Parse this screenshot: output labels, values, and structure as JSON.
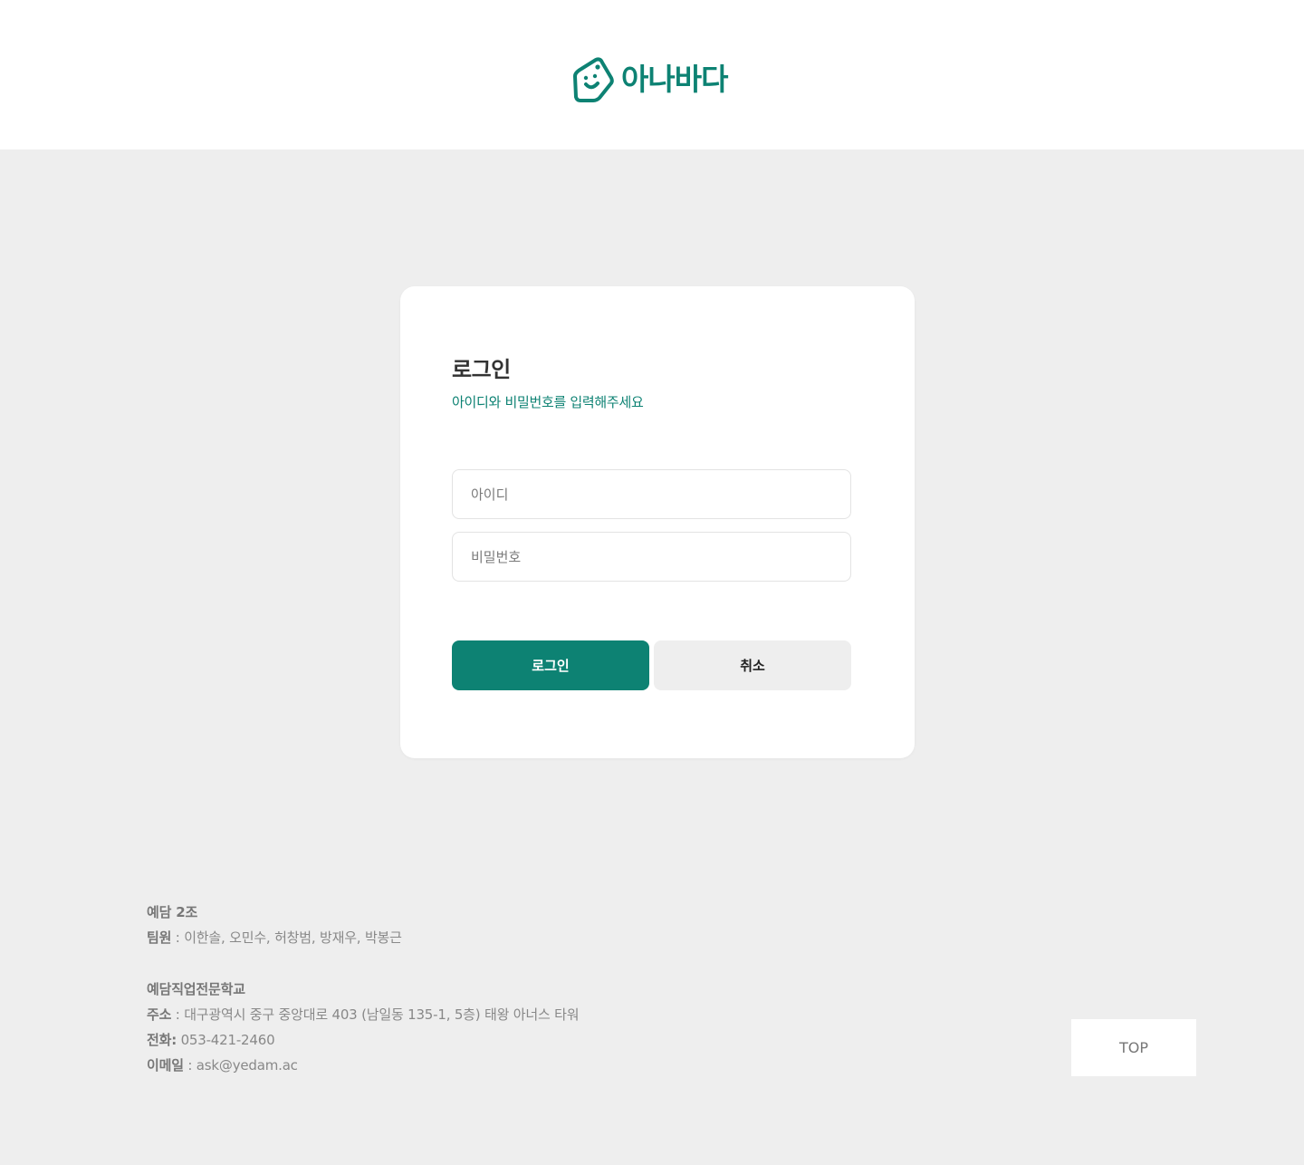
{
  "header": {
    "logo_icon": "price-tag-smile-icon",
    "logo_text": "아나바다",
    "brand_color": "#0d8273"
  },
  "login": {
    "title": "로그인",
    "subtitle": "아이디와 비밀번호를 입력해주세요",
    "id_placeholder": "아이디",
    "id_value": "",
    "password_placeholder": "비밀번호",
    "password_value": "",
    "login_label": "로그인",
    "cancel_label": "취소"
  },
  "footer": {
    "team_name": "예담 2조",
    "members_label": "팀원",
    "members": " : 이한솔, 오민수, 허창범, 방재우, 박봉근",
    "school_name": "예담직업전문학교",
    "address_label": "주소",
    "address": " : 대구광역시 중구 중앙대로 403 (남일동 135-1, 5층) 태왕 아너스 타워",
    "phone_label": "전화:",
    "phone": " 053-421-2460",
    "email_label": "이메일",
    "email": " : ask@yedam.ac"
  },
  "top_button": {
    "label": "TOP"
  }
}
